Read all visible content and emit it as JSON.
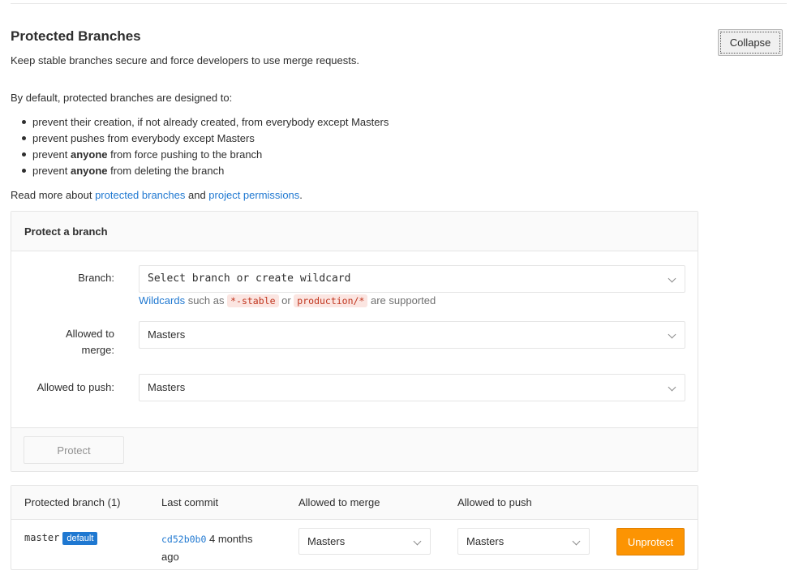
{
  "header": {
    "title": "Protected Branches",
    "subtitle": "Keep stable branches secure and force developers to use merge requests.",
    "collapse_label": "Collapse"
  },
  "intro": {
    "lead": "By default, protected branches are designed to:",
    "bullets": [
      {
        "pre": "prevent their creation, if not already created, from everybody except Masters",
        "strong": "",
        "post": ""
      },
      {
        "pre": "prevent pushes from everybody except Masters",
        "strong": "",
        "post": ""
      },
      {
        "pre": "prevent ",
        "strong": "anyone",
        "post": " from force pushing to the branch"
      },
      {
        "pre": "prevent ",
        "strong": "anyone",
        "post": " from deleting the branch"
      }
    ],
    "readmore_prefix": "Read more about ",
    "readmore_link1": "protected branches",
    "readmore_and": " and ",
    "readmore_link2": "project permissions",
    "readmore_suffix": "."
  },
  "protect_form": {
    "heading": "Protect a branch",
    "branch_label": "Branch:",
    "branch_placeholder": "Select branch or create wildcard",
    "help_link": "Wildcards",
    "help_such_as": " such as ",
    "help_example1": "*-stable",
    "help_or": " or ",
    "help_example2": "production/*",
    "help_supported": " are supported",
    "merge_label_line1": "Allowed to",
    "merge_label_line2": "merge:",
    "merge_value": "Masters",
    "push_label": "Allowed to push:",
    "push_value": "Masters",
    "protect_button": "Protect"
  },
  "table": {
    "headers": [
      "Protected branch (1)",
      "Last commit",
      "Allowed to merge",
      "Allowed to push"
    ],
    "rows": [
      {
        "branch": "master",
        "badge": "default",
        "commit_sha": "cd52b0b0",
        "commit_time_line1": " 4 months",
        "commit_time_line2": "ago",
        "merge": "Masters",
        "push": "Masters",
        "action": "Unprotect"
      }
    ]
  }
}
